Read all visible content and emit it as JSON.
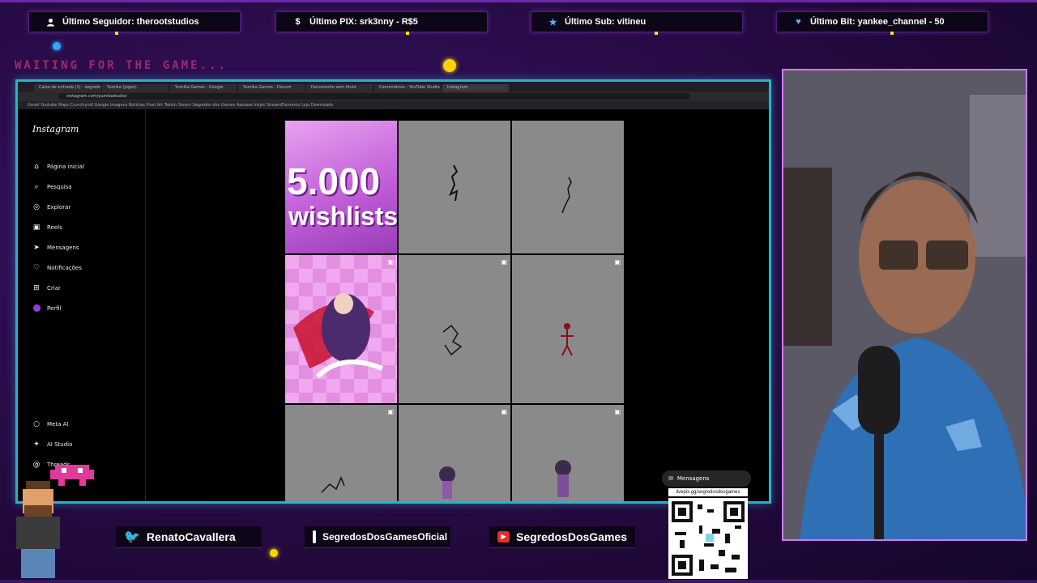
{
  "overlay": {
    "alerts": [
      {
        "icon": "user-icon",
        "label": "Último Seguidor: therootstudios"
      },
      {
        "icon": "dollar-icon",
        "label": "Último PIX: srk3nny - R$5"
      },
      {
        "icon": "star-icon",
        "label": "Último Sub: vitineu"
      },
      {
        "icon": "heart-icon",
        "label": "Último Bit: yankee_channel - 50"
      }
    ],
    "waiting_text": "WAITING FOR THE GAME..."
  },
  "browser": {
    "tabs": [
      "Caixa de entrada (1) - segredos",
      "Yumika (Jogos)",
      "Yumika Games - Google",
      "Yumika Games - Docum",
      "Documento sem título",
      "Comentários - YouTube Studio",
      "Instagram"
    ],
    "url": "instagram.com/yumikastudio/",
    "bookmarks": "Gmail   Youtube   Maps   Crunchyroll   Google Imagens   Notícias   Pixel Art   Twitch   Steam   Segredos dos Games   Apoiase   Inkjet   StreamElements   Loja   Downloads",
    "instagram": {
      "logo": "Instagram",
      "nav": [
        {
          "icon": "home-icon",
          "label": "Página inicial"
        },
        {
          "icon": "search-icon",
          "label": "Pesquisa"
        },
        {
          "icon": "compass-icon",
          "label": "Explorar"
        },
        {
          "icon": "reels-icon",
          "label": "Reels"
        },
        {
          "icon": "send-icon",
          "label": "Mensagens"
        },
        {
          "icon": "heart-icon",
          "label": "Notificações"
        },
        {
          "icon": "plus-icon",
          "label": "Criar"
        },
        {
          "icon": "profile-icon",
          "label": "Perfil"
        }
      ],
      "nav_bottom": [
        {
          "icon": "meta-ai-icon",
          "label": "Meta AI"
        },
        {
          "icon": "ai-studio-icon",
          "label": "AI Studio"
        },
        {
          "icon": "threads-icon",
          "label": "Threads"
        }
      ],
      "post_text": {
        "number": "5.000",
        "word": "wishlists"
      },
      "chat_label": "Mensagens"
    }
  },
  "socials": {
    "twitter": "RenatoCavallera",
    "instagram": "SegredosDosGamesOficial",
    "youtube": "SegredosDosGames",
    "qr_link": "livepix.gg/segredosdosgames"
  },
  "colors": {
    "background": "#2a0d4a",
    "browser_border": "#26b3c6",
    "cam_border": "#c57df0",
    "accent_yellow": "#f5e50f"
  }
}
